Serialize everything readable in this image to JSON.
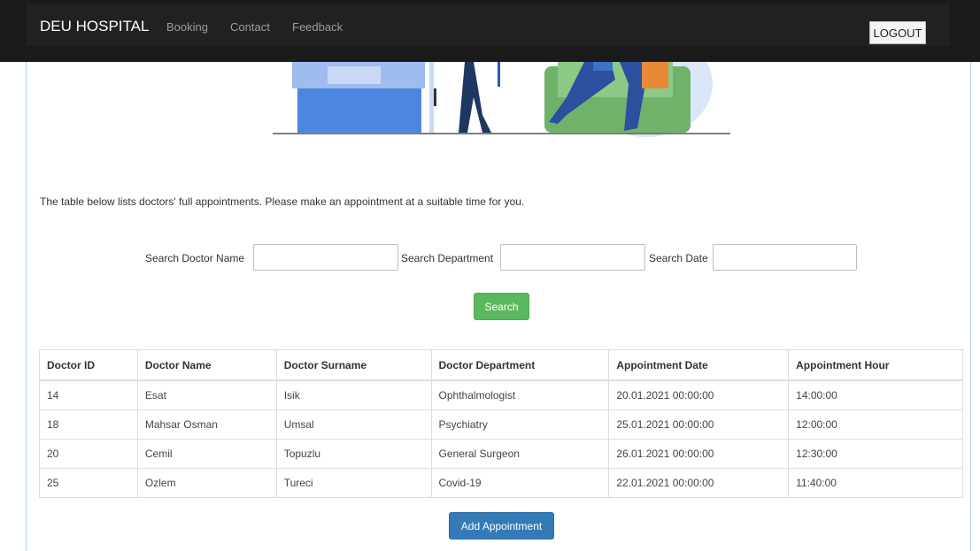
{
  "navbar": {
    "brand": "DEU HOSPITAL",
    "links": [
      "Booking",
      "Contact",
      "Feedback"
    ],
    "logout_label": "LOGOUT"
  },
  "intro_text": "The table below lists doctors' full appointments. Please make an appointment at a suitable time for you.",
  "search": {
    "doctor_name_label": "Search Doctor Name",
    "doctor_name_value": "",
    "department_label": "Search Department",
    "department_value": "",
    "date_label": "Search Date",
    "date_value": "",
    "button_label": "Search"
  },
  "table": {
    "headers": [
      "Doctor ID",
      "Doctor Name",
      "Doctor Surname",
      "Doctor Department",
      "Appointment Date",
      "Appointment Hour"
    ],
    "rows": [
      [
        "14",
        "Esat",
        "Isik",
        "Ophthalmologist",
        "20.01.2021 00:00:00",
        "14:00:00"
      ],
      [
        "18",
        "Mahsar Osman",
        "Umsal",
        "Psychiatry",
        "25.01.2021 00:00:00",
        "12:00:00"
      ],
      [
        "20",
        "Cemil",
        "Topuzlu",
        "General Surgeon",
        "26.01.2021 00:00:00",
        "12:30:00"
      ],
      [
        "25",
        "Ozlem",
        "Tureci",
        "Covid-19",
        "22.01.2021 00:00:00",
        "11:40:00"
      ]
    ]
  },
  "add_button_label": "Add Appointment",
  "colors": {
    "navbar_bg": "#212121",
    "search_button": "#5cb85c",
    "add_button": "#337ab7"
  }
}
